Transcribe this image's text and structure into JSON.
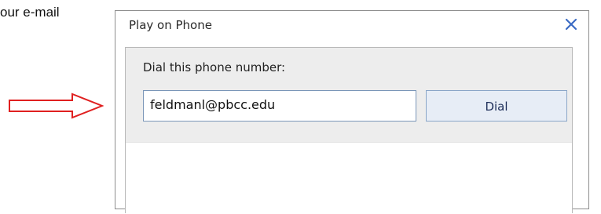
{
  "background": {
    "partial_text": "our e-mail"
  },
  "annotation": {
    "arrow_color": "#e02020"
  },
  "dialog": {
    "title": "Play on Phone",
    "close_icon": "close-icon",
    "dial_label": "Dial this phone number:",
    "phone_input_value": "feldmanl@pbcc.edu",
    "dial_button_label": "Dial",
    "accent_color": "#3b6bc4"
  }
}
